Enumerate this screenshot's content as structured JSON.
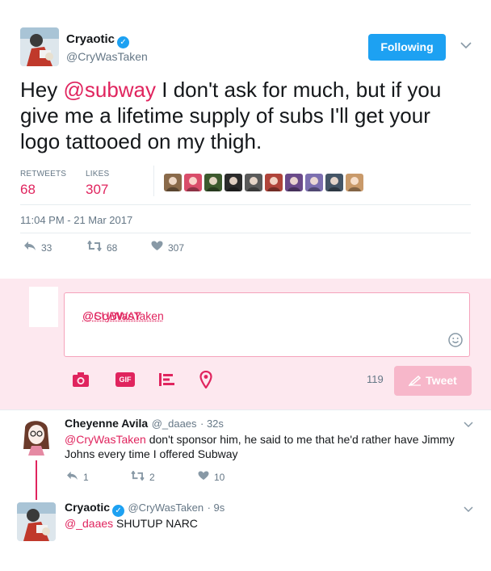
{
  "tweet": {
    "name": "Cryaotic",
    "handle": "@CryWasTaken",
    "follow_label": "Following",
    "text_before": "Hey ",
    "text_mention": "@subway",
    "text_after": " I don't ask for much, but if you give me a lifetime supply of subs I'll get your logo tattooed on my thigh.",
    "retweets_label": "RETWEETS",
    "retweets_value": "68",
    "likes_label": "LIKES",
    "likes_value": "307",
    "timestamp": "11:04 PM - 21 Mar 2017",
    "reply_count": "33",
    "retweet_count": "68",
    "like_count": "307",
    "liker_colors": [
      "#8a6a4a",
      "#d94d6a",
      "#3d5a2e",
      "#2b2b2b",
      "#5a5a5a",
      "#b0443a",
      "#6a4a8a",
      "#7c6fb0",
      "#445566",
      "#c99a6a"
    ]
  },
  "reply_box": {
    "mention1": "@CryWasTaken",
    "mention2": "@SUBWAY",
    "counter": "119",
    "tweet_label": "Tweet",
    "gif_label": "GIF"
  },
  "replies": [
    {
      "name": "Cheyenne Avila",
      "handle": "@_daaes",
      "time": "· 32s",
      "mention": "@CryWasTaken",
      "text": " don't sponsor him, he said to me that he'd rather have Jimmy Johns every time I offered Subway",
      "reply_count": "1",
      "retweet_count": "2",
      "like_count": "10"
    },
    {
      "name": "Cryaotic",
      "handle": "@CryWasTaken",
      "time": "· 9s",
      "mention": "@_daaes",
      "text": " SHUTUP NARC"
    }
  ],
  "colors": {
    "accent": "#e0245e",
    "twitter_blue": "#1da1f2",
    "reply_bg": "#fde8ef"
  }
}
